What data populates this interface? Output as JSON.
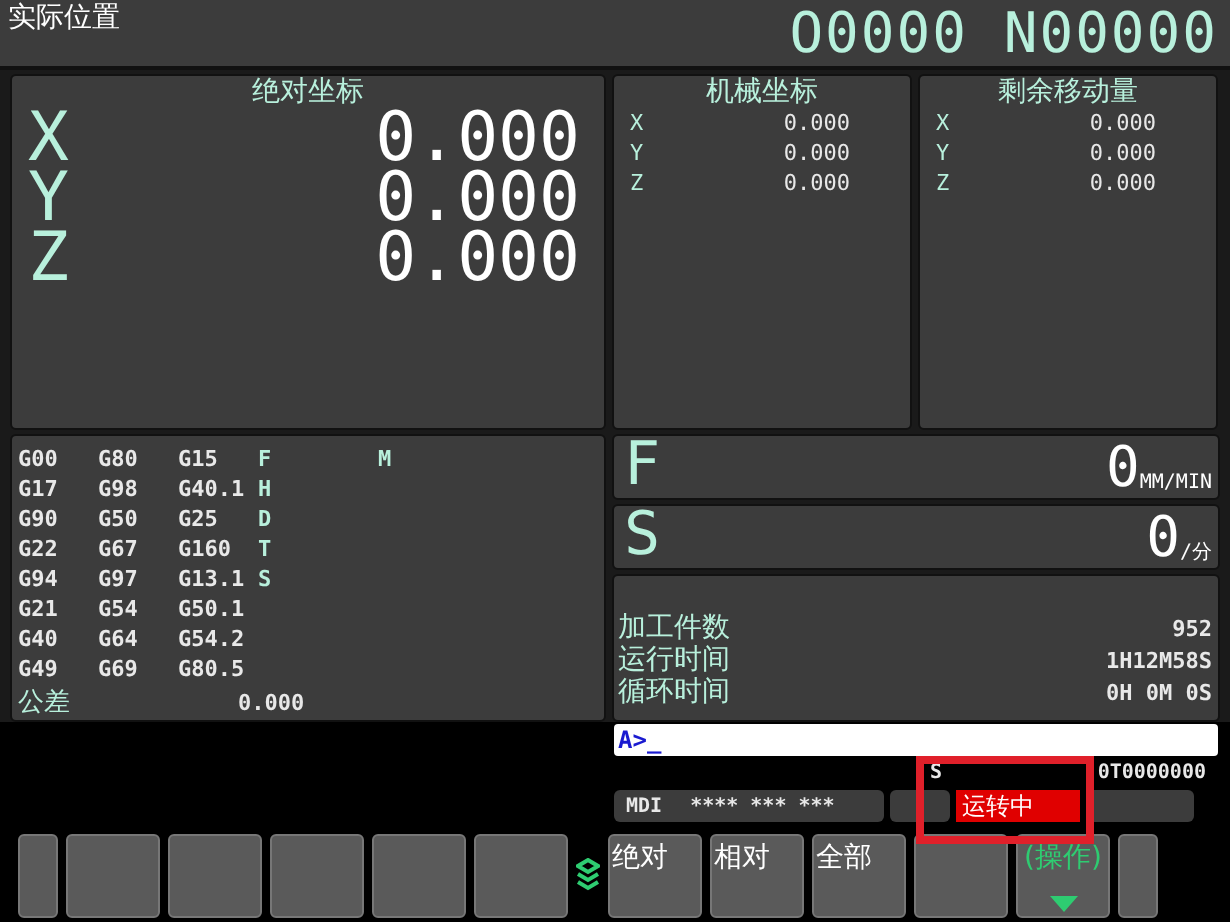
{
  "header": {
    "title": "实际位置",
    "program": "O0000 N00000"
  },
  "absolute": {
    "title": "绝对坐标",
    "axes": [
      {
        "axis": "X",
        "value": "0.000"
      },
      {
        "axis": "Y",
        "value": "0.000"
      },
      {
        "axis": "Z",
        "value": "0.000"
      }
    ]
  },
  "machine": {
    "title": "机械坐标",
    "axes": [
      {
        "axis": "X",
        "value": "0.000"
      },
      {
        "axis": "Y",
        "value": "0.000"
      },
      {
        "axis": "Z",
        "value": "0.000"
      }
    ]
  },
  "distance_to_go": {
    "title": "剩余移动量",
    "axes": [
      {
        "axis": "X",
        "value": "0.000"
      },
      {
        "axis": "Y",
        "value": "0.000"
      },
      {
        "axis": "Z",
        "value": "0.000"
      }
    ]
  },
  "modal": {
    "rows": [
      {
        "codes": [
          "G00",
          "G80",
          "G15"
        ],
        "letter": "F",
        "extra": "M"
      },
      {
        "codes": [
          "G17",
          "G98",
          "G40.1"
        ],
        "letter": "H"
      },
      {
        "codes": [
          "G90",
          "G50",
          "G25"
        ],
        "letter": "D"
      },
      {
        "codes": [
          "G22",
          "G67",
          "G160"
        ],
        "letter": "T"
      },
      {
        "codes": [
          "G94",
          "G97",
          "G13.1"
        ],
        "letter": "S"
      },
      {
        "codes": [
          "G21",
          "G54",
          "G50.1"
        ]
      },
      {
        "codes": [
          "G40",
          "G64",
          "G54.2"
        ]
      },
      {
        "codes": [
          "G49",
          "G69",
          "G80.5"
        ]
      }
    ],
    "tolerance": {
      "label": "公差",
      "value": "0.000"
    }
  },
  "feed": {
    "letter": "F",
    "value": "0",
    "unit": "MM/MIN"
  },
  "spindle": {
    "letter": "S",
    "value": "0",
    "unit": "/分"
  },
  "counters": [
    {
      "label": "加工件数",
      "value": "952"
    },
    {
      "label": "运行时间",
      "value": "1H12M58S"
    },
    {
      "label": "循环时间",
      "value": "0H 0M 0S"
    }
  ],
  "input": {
    "value": "A>_"
  },
  "status": {
    "spindle_label": "S",
    "tool": "0T0000000",
    "mode": "MDI",
    "flags": "**** *** ***",
    "alarm": "运转中"
  },
  "softkeys": [
    {
      "kind": "blank"
    },
    {
      "kind": "blank"
    },
    {
      "kind": "blank"
    },
    {
      "kind": "blank"
    },
    {
      "kind": "blank"
    },
    {
      "kind": "blank"
    },
    {
      "kind": "label",
      "label": "绝对",
      "more": false
    },
    {
      "kind": "label",
      "label": "相对",
      "more": false
    },
    {
      "kind": "label",
      "label": "全部",
      "more": false
    },
    {
      "kind": "blank"
    },
    {
      "kind": "label",
      "label": "(操作)",
      "more": true
    },
    {
      "kind": "blank"
    }
  ]
}
